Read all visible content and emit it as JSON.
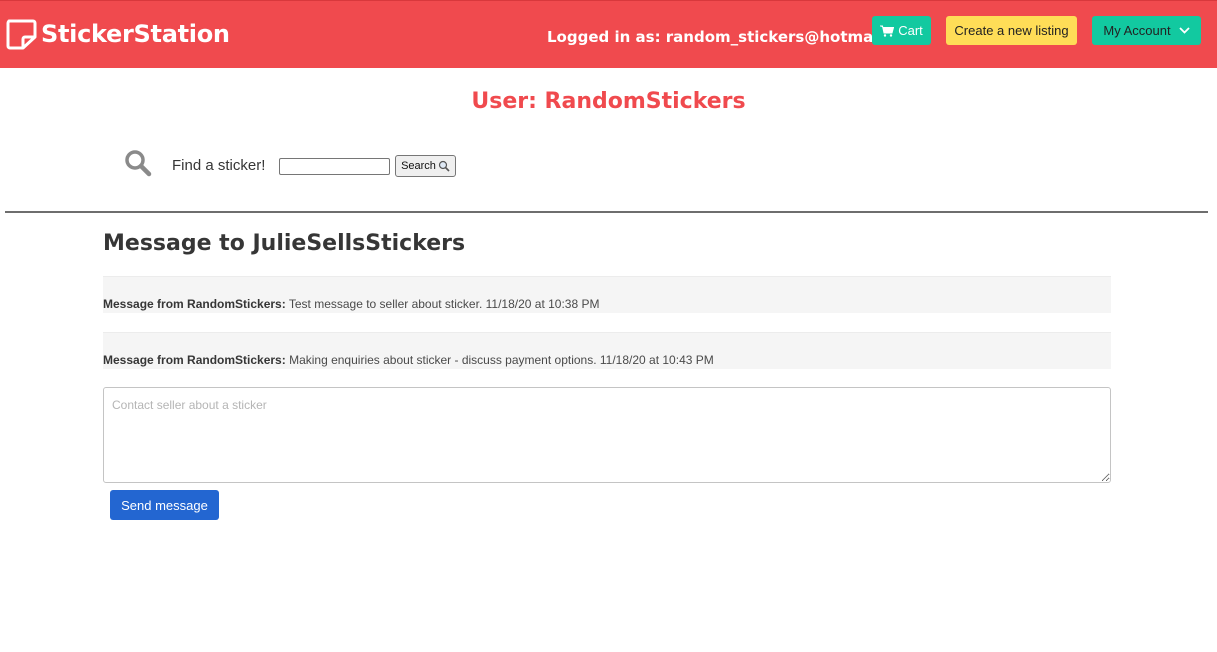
{
  "brand": {
    "name": "StickerStation",
    "icon": "sticker-note-icon"
  },
  "header": {
    "logged_in_text": "Logged in as: random_stickers@hotmail.com",
    "cart_label": "Cart",
    "cart_icon": "cart-icon",
    "create_label": "Create a new listing",
    "account_label": "My Account",
    "account_icon": "chevron-down-icon"
  },
  "profile": {
    "title": "User: RandomStickers"
  },
  "search": {
    "label": "Find a sticker!",
    "value": "",
    "button_label": "Search",
    "icon": "search-icon"
  },
  "conversation": {
    "title": "Message to JulieSellsStickers",
    "messages": [
      {
        "from": "Message from RandomStickers:",
        "text": " Test message to seller about sticker. 11/18/20 at 10:38 PM"
      },
      {
        "from": "Message from RandomStickers:",
        "text": " Making enquiries about sticker - discuss payment options. 11/18/20 at 10:43 PM"
      }
    ],
    "compose_placeholder": "Contact seller about a sticker",
    "compose_value": "",
    "send_label": "Send message"
  },
  "colors": {
    "navbar": "#f04a4e",
    "teal": "#12c9a0",
    "yellow": "#ffdd57",
    "primary": "#2366d1"
  }
}
